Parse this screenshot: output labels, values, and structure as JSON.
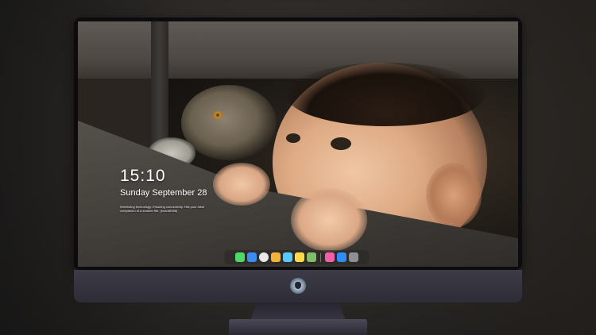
{
  "lockscreen": {
    "time": "15:10",
    "date": "Sunday September 28",
    "tagline": "Interesting technology. Ensuring connectivity. Hits your ideal companion of a smarter life. (board6988)"
  },
  "dock": {
    "icons": [
      {
        "name": "messages-icon",
        "color": "#4cd964"
      },
      {
        "name": "finder-icon",
        "color": "#3b8cf0"
      },
      {
        "name": "clock-icon",
        "color": "#e8e8e8"
      },
      {
        "name": "photos-icon",
        "color": "#f2b13a"
      },
      {
        "name": "video-icon",
        "color": "#5ac8fa"
      },
      {
        "name": "notes-icon",
        "color": "#ffd94a"
      },
      {
        "name": "preview-icon",
        "color": "#7fbf6a"
      },
      {
        "name": "music-icon",
        "color": "#f25fa8"
      },
      {
        "name": "appstore-icon",
        "color": "#2f8ef5"
      },
      {
        "name": "settings-icon",
        "color": "#8e8e93"
      }
    ]
  }
}
